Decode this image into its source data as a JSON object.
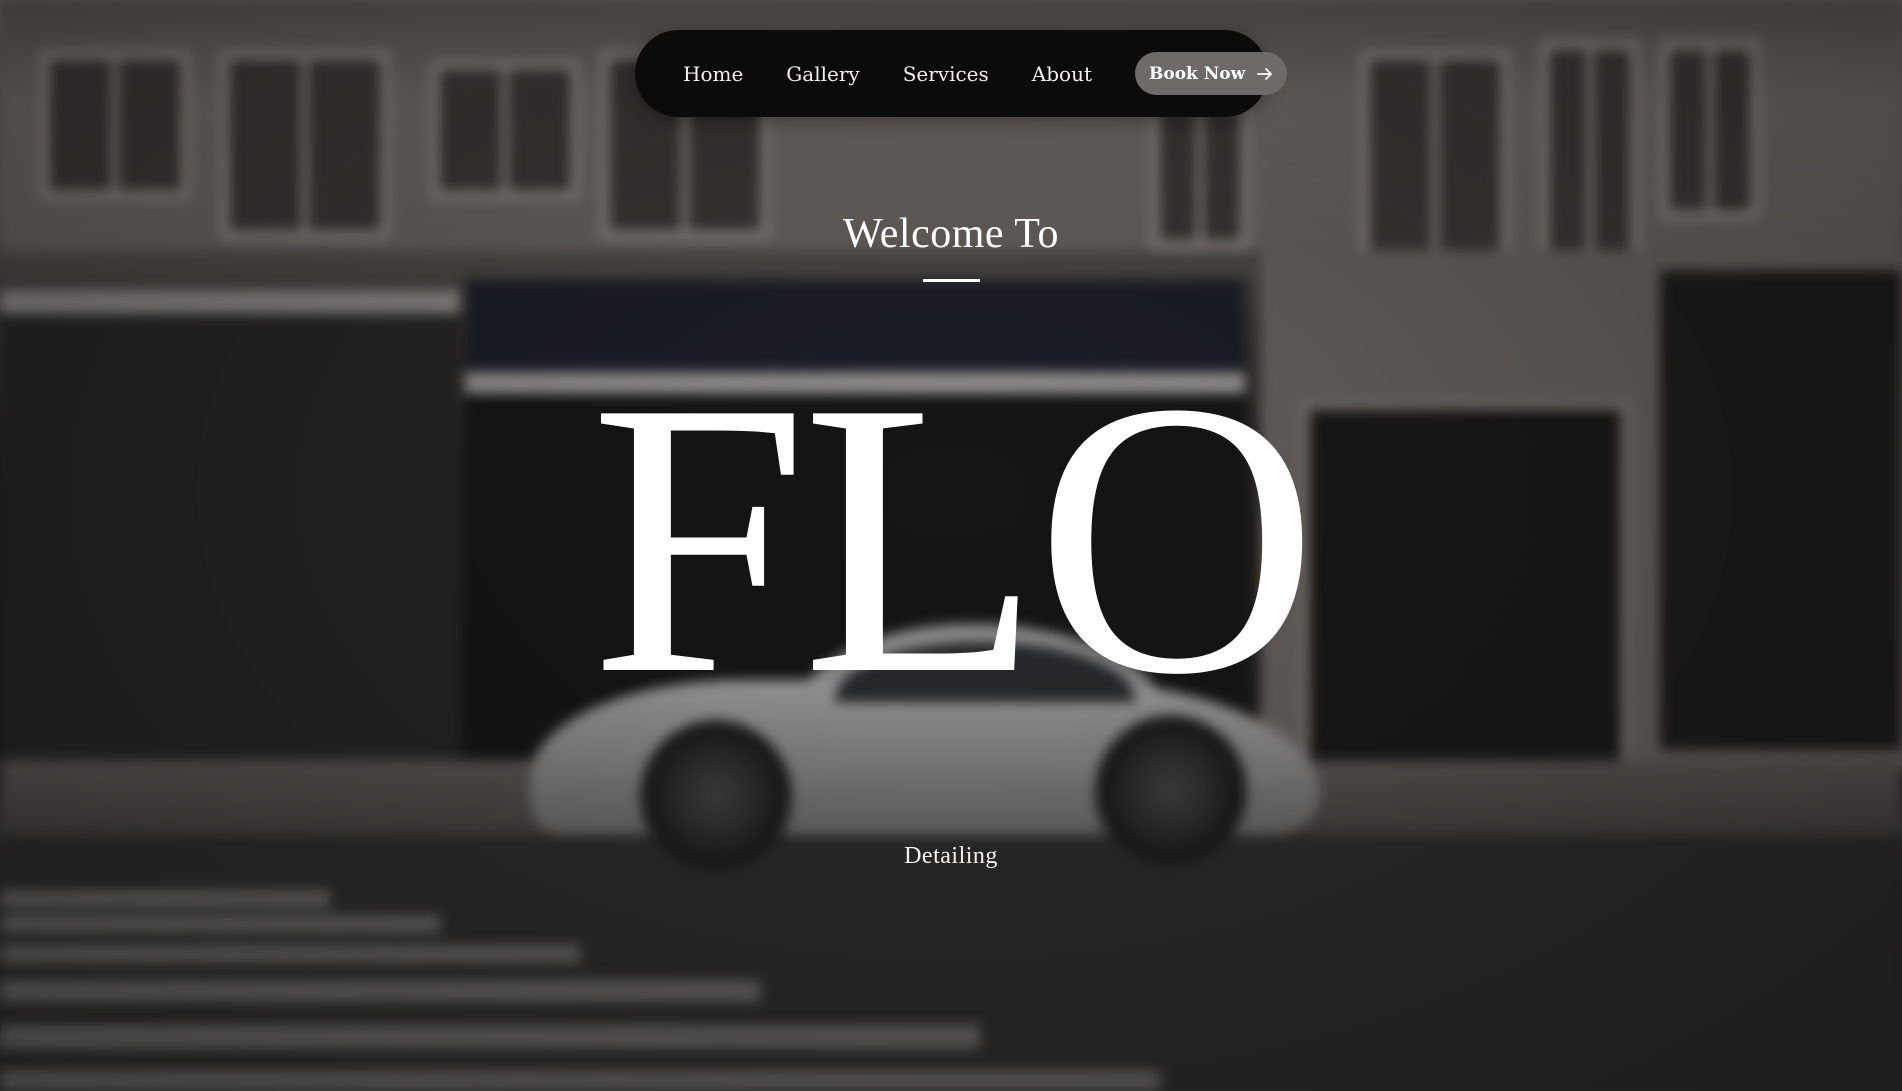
{
  "nav": {
    "links": [
      {
        "label": "Home"
      },
      {
        "label": "Gallery"
      },
      {
        "label": "Services"
      },
      {
        "label": "About"
      }
    ],
    "cta_label": "Book Now",
    "cta_icon": "arrow-right-icon"
  },
  "hero": {
    "welcome": "Welcome To",
    "brand": "FLO",
    "subtitle": "Detailing",
    "background": "blurred-street-photo-silver-sports-car"
  },
  "colors": {
    "nav_bg": "#0c0b0b",
    "cta_bg": "#6d6a68",
    "text": "#ffffff"
  }
}
